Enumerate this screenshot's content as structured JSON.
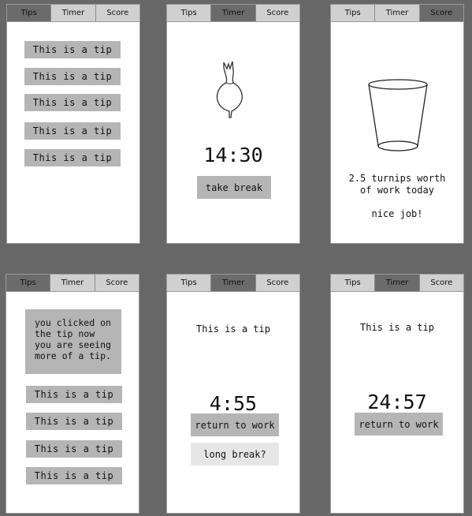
{
  "tabs": [
    "Tips",
    "Timer",
    "Score"
  ],
  "screen1": {
    "tips": [
      "This is a tip",
      "This is a tip",
      "This is a tip",
      "This is a tip",
      "This is a tip"
    ]
  },
  "screen2": {
    "time": "14:30",
    "button": "take break",
    "image_icon": "turnip-icon"
  },
  "screen3": {
    "line1": "2.5 turnips worth",
    "line2": "of work today",
    "praise": "nice job!",
    "image_icon": "cup-icon"
  },
  "screen4": {
    "expanded_lines": [
      "you clicked on",
      "the tip now",
      "you are seeing",
      "more of a tip."
    ],
    "tips": [
      "This is a tip",
      "This is a tip",
      "This is a tip",
      "This is a tip"
    ]
  },
  "screen5": {
    "tip": "This is a tip",
    "time": "4:55",
    "return_button": "return to work",
    "long_break_button": "long break?"
  },
  "screen6": {
    "tip": "This is a tip",
    "time": "24:57",
    "return_button": "return to work"
  },
  "colors": {
    "background": "#676767",
    "panel": "#ffffff",
    "active_tab": "#6b6b6b",
    "inactive_tab": "#d0d0d0",
    "button": "#b5b5b5",
    "light_button": "#e6e6e6"
  }
}
